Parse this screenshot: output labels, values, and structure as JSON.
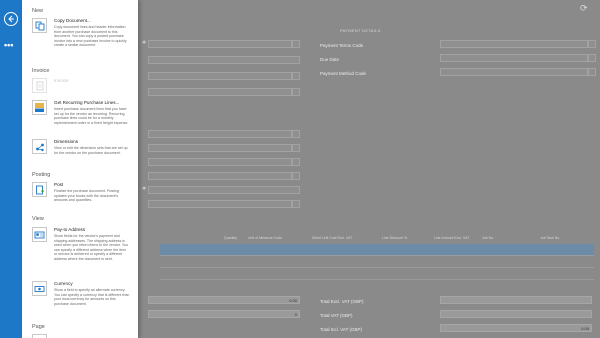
{
  "window": {
    "back_icon": "back-arrow-icon",
    "more_icon": "more-ellipsis-icon",
    "refresh_icon": "refresh-icon"
  },
  "menu": {
    "sections": [
      {
        "key": "new",
        "label": "New"
      },
      {
        "key": "invoice",
        "label": "Invoice"
      },
      {
        "key": "posting",
        "label": "Posting"
      },
      {
        "key": "view",
        "label": "View"
      },
      {
        "key": "page",
        "label": "Page"
      }
    ],
    "items": [
      {
        "title": "Copy Document...",
        "description": "Copy document lines and header information from another purchase document to this document. You can copy a posted purchase invoice into a new purchase invoice to quickly create a similar document.",
        "icon": "copy-document-icon",
        "enabled": true
      },
      {
        "title": "Invoice",
        "description": "",
        "icon": "invoice-icon",
        "enabled": false
      },
      {
        "title": "Get Recurring Purchase Lines...",
        "description": "Insert purchase document lines that you have set up for the vendor as recurring. Recurring purchase lines could be for a monthly replenishment order or a fixed freight expense.",
        "icon": "recurring-lines-icon",
        "enabled": true
      },
      {
        "title": "Dimensions",
        "description": "View or edit the dimension sets that are set up for the vendor on the purchase document.",
        "icon": "dimensions-icon",
        "enabled": true
      },
      {
        "title": "Post",
        "description": "Finalize the purchase document. Posting updates your books with the document's amounts and quantities.",
        "icon": "post-icon",
        "enabled": true
      },
      {
        "title": "Pay-to Address",
        "description": "Show fields for the vendor's payment and shipping addresses. The shipping address is used when you return items to the vendor. You can specify a different address when the item or service is delivered or specify a different address where the document is sent.",
        "icon": "pay-to-address-icon",
        "enabled": true
      },
      {
        "title": "Currency",
        "description": "Show a field to specify an alternate currency. You can specify a currency that is different than your local currency for amounts on this purchase document.",
        "icon": "currency-icon",
        "enabled": true
      }
    ]
  },
  "background": {
    "payment_details_header": "PAYMENT DETAILS",
    "payment_fields": [
      "Payment Terms Code",
      "Due Date",
      "Payment Method Code"
    ],
    "line_columns": [
      "Quantity",
      "Unit of Measure Code",
      "Direct Unit Cost Excl. VAT",
      "Line Discount %",
      "Line Amount Excl. VAT",
      "Job No.",
      "Job Task No."
    ],
    "totals": [
      {
        "label": "Total Excl. VAT (GBP)",
        "value": ""
      },
      {
        "label": "Total VAT (GBP)",
        "value": ""
      },
      {
        "label": "Total Incl. VAT (GBP)",
        "value": "0.00"
      }
    ],
    "left_totals_values": [
      "0.00",
      "0"
    ]
  },
  "colors": {
    "accent": "#1e78c8",
    "panel": "#ffffff",
    "overlay": "#8a8a8a"
  }
}
